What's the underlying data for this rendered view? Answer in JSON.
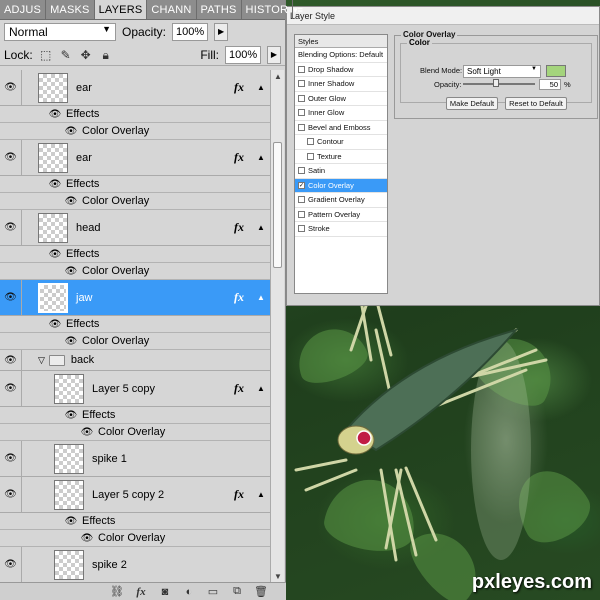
{
  "panel": {
    "tabs": [
      {
        "label": "ADJUS",
        "active": false
      },
      {
        "label": "MASKS",
        "active": false
      },
      {
        "label": "LAYERS",
        "active": true
      },
      {
        "label": "CHANN",
        "active": false
      },
      {
        "label": "PATHS",
        "active": false
      },
      {
        "label": "HISTOR",
        "active": false
      }
    ],
    "blend_mode": "Normal",
    "opacity_label": "Opacity:",
    "opacity_value": "100%",
    "lock_label": "Lock:",
    "fill_label": "Fill:",
    "fill_value": "100%"
  },
  "layers": [
    {
      "name": "ear",
      "fx": "fx",
      "selected": false,
      "indent": false,
      "effects": "Effects",
      "effect": "Color Overlay"
    },
    {
      "name": "ear",
      "fx": "fx",
      "selected": false,
      "indent": false,
      "effects": "Effects",
      "effect": "Color Overlay"
    },
    {
      "name": "head",
      "fx": "fx",
      "selected": false,
      "indent": false,
      "effects": "Effects",
      "effect": "Color Overlay"
    },
    {
      "name": "jaw",
      "fx": "fx",
      "selected": true,
      "indent": false,
      "effects": "Effects",
      "effect": "Color Overlay"
    }
  ],
  "group": {
    "name": "back"
  },
  "group_layers": [
    {
      "name": "Layer 5 copy",
      "fx": "fx",
      "effects": "Effects",
      "effect": "Color Overlay"
    },
    {
      "name": "spike 1"
    },
    {
      "name": "Layer 5 copy 2",
      "fx": "fx",
      "effects": "Effects",
      "effect": "Color Overlay"
    },
    {
      "name": "spike 2"
    }
  ],
  "dialog": {
    "title": "Layer Style",
    "styles_header": "Styles",
    "styles": [
      {
        "label": "Blending Options: Default",
        "checkbox": false,
        "checked": false,
        "indent": false,
        "selected": false
      },
      {
        "label": "Drop Shadow",
        "checkbox": true,
        "checked": false,
        "indent": false,
        "selected": false
      },
      {
        "label": "Inner Shadow",
        "checkbox": true,
        "checked": false,
        "indent": false,
        "selected": false
      },
      {
        "label": "Outer Glow",
        "checkbox": true,
        "checked": false,
        "indent": false,
        "selected": false
      },
      {
        "label": "Inner Glow",
        "checkbox": true,
        "checked": false,
        "indent": false,
        "selected": false
      },
      {
        "label": "Bevel and Emboss",
        "checkbox": true,
        "checked": false,
        "indent": false,
        "selected": false
      },
      {
        "label": "Contour",
        "checkbox": true,
        "checked": false,
        "indent": true,
        "selected": false
      },
      {
        "label": "Texture",
        "checkbox": true,
        "checked": false,
        "indent": true,
        "selected": false
      },
      {
        "label": "Satin",
        "checkbox": true,
        "checked": false,
        "indent": false,
        "selected": false
      },
      {
        "label": "Color Overlay",
        "checkbox": true,
        "checked": true,
        "indent": false,
        "selected": true
      },
      {
        "label": "Gradient Overlay",
        "checkbox": true,
        "checked": false,
        "indent": false,
        "selected": false
      },
      {
        "label": "Pattern Overlay",
        "checkbox": true,
        "checked": false,
        "indent": false,
        "selected": false
      },
      {
        "label": "Stroke",
        "checkbox": true,
        "checked": false,
        "indent": false,
        "selected": false
      }
    ],
    "section_title": "Color Overlay",
    "subsection_title": "Color",
    "blend_mode_label": "Blend Mode:",
    "blend_mode_value": "Soft Light",
    "overlay_color": "#a4d47c",
    "opacity_label": "Opacity:",
    "opacity_value": "50",
    "opacity_unit": "%",
    "make_default": "Make Default",
    "reset_default": "Reset to Default"
  },
  "watermark": "pxleyes.com",
  "colors": {
    "selection": "#3a9af7",
    "panel_bg": "#d6d6d6"
  }
}
